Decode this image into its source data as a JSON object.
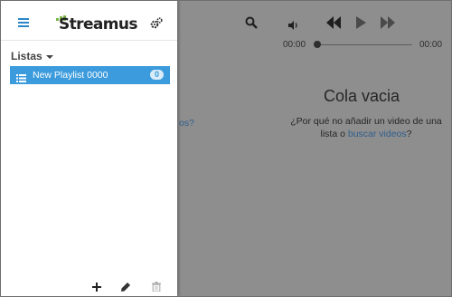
{
  "app": {
    "logo_text": "Streamus",
    "accent_color": "#3b9bdc"
  },
  "player": {
    "current_time": "00:00",
    "total_time": "00:00",
    "progress": 0,
    "icons": [
      "search-icon",
      "volume-icon",
      "previous-icon",
      "play-icon",
      "next-icon"
    ]
  },
  "queue": {
    "empty_title": "Cola vacia",
    "empty_text_prefix": "¿Por qué no añadir un video de una lista o ",
    "empty_text_link": "buscar videos",
    "empty_text_suffix": "?",
    "ghost_link": "os?"
  },
  "sidebar": {
    "section_label": "Listas",
    "playlists": [
      {
        "name": "New Playlist 0000",
        "count": "0"
      }
    ]
  }
}
